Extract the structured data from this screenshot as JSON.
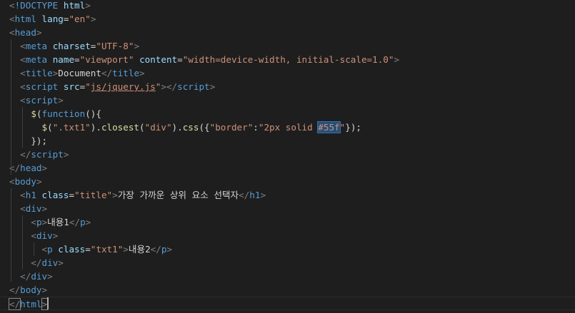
{
  "editor": {
    "lines": [
      [
        [
          "br",
          "<"
        ],
        [
          "tag",
          "!DOCTYPE"
        ],
        [
          "txt",
          " "
        ],
        [
          "attr",
          "html"
        ],
        [
          "br",
          ">"
        ]
      ],
      [
        [
          "br",
          "<"
        ],
        [
          "tag",
          "html"
        ],
        [
          "txt",
          " "
        ],
        [
          "attr",
          "lang"
        ],
        [
          "txt",
          "="
        ],
        [
          "str",
          "\"en\""
        ],
        [
          "br",
          ">"
        ]
      ],
      [
        [
          "br",
          "<"
        ],
        [
          "tag",
          "head"
        ],
        [
          "br",
          ">"
        ]
      ],
      [
        [
          "txt",
          "  "
        ],
        [
          "br",
          "<"
        ],
        [
          "tag",
          "meta"
        ],
        [
          "txt",
          " "
        ],
        [
          "attr",
          "charset"
        ],
        [
          "txt",
          "="
        ],
        [
          "str",
          "\"UTF-8\""
        ],
        [
          "br",
          ">"
        ]
      ],
      [
        [
          "txt",
          "  "
        ],
        [
          "br",
          "<"
        ],
        [
          "tag",
          "meta"
        ],
        [
          "txt",
          " "
        ],
        [
          "attr",
          "name"
        ],
        [
          "txt",
          "="
        ],
        [
          "str",
          "\"viewport\""
        ],
        [
          "txt",
          " "
        ],
        [
          "attr",
          "content"
        ],
        [
          "txt",
          "="
        ],
        [
          "str",
          "\"width=device-width, initial-scale=1.0\""
        ],
        [
          "br",
          ">"
        ]
      ],
      [
        [
          "txt",
          "  "
        ],
        [
          "br",
          "<"
        ],
        [
          "tag",
          "title"
        ],
        [
          "br",
          ">"
        ],
        [
          "txt",
          "Document"
        ],
        [
          "br",
          "</"
        ],
        [
          "tag",
          "title"
        ],
        [
          "br",
          ">"
        ]
      ],
      [
        [
          "txt",
          "  "
        ],
        [
          "br",
          "<"
        ],
        [
          "tag",
          "script"
        ],
        [
          "txt",
          " "
        ],
        [
          "attr",
          "src"
        ],
        [
          "txt",
          "="
        ],
        [
          "str",
          "\""
        ],
        [
          "link",
          "js/jquery.js"
        ],
        [
          "str",
          "\""
        ],
        [
          "br",
          "></"
        ],
        [
          "tag",
          "script"
        ],
        [
          "br",
          ">"
        ]
      ],
      [
        [
          "txt",
          "  "
        ],
        [
          "br",
          "<"
        ],
        [
          "tag",
          "script"
        ],
        [
          "br",
          ">"
        ]
      ],
      [
        [
          "txt",
          "    "
        ],
        [
          "fn",
          "$"
        ],
        [
          "punc",
          "("
        ],
        [
          "kw",
          "function"
        ],
        [
          "punc",
          "(){"
        ]
      ],
      [
        [
          "txt",
          "      "
        ],
        [
          "fn",
          "$"
        ],
        [
          "punc",
          "("
        ],
        [
          "str",
          "\".txt1\""
        ],
        [
          "punc",
          ")."
        ],
        [
          "fn",
          "closest"
        ],
        [
          "punc",
          "("
        ],
        [
          "str",
          "\"div\""
        ],
        [
          "punc",
          ")."
        ],
        [
          "fn",
          "css"
        ],
        [
          "punc",
          "({"
        ],
        [
          "str",
          "\"border\""
        ],
        [
          "punc",
          ":"
        ],
        [
          "str",
          "\"2px solid "
        ],
        [
          "sel",
          "#55f"
        ],
        [
          "str",
          "\""
        ],
        [
          "punc",
          "});"
        ]
      ],
      [
        [
          "txt",
          "    "
        ],
        [
          "punc",
          "});"
        ]
      ],
      [
        [
          "txt",
          "  "
        ],
        [
          "br",
          "</"
        ],
        [
          "tag",
          "script"
        ],
        [
          "br",
          ">"
        ]
      ],
      [
        [
          "br",
          "</"
        ],
        [
          "tag",
          "head"
        ],
        [
          "br",
          ">"
        ]
      ],
      [
        [
          "br",
          "<"
        ],
        [
          "tag",
          "body"
        ],
        [
          "br",
          ">"
        ]
      ],
      [
        [
          "txt",
          "  "
        ],
        [
          "br",
          "<"
        ],
        [
          "tag",
          "h1"
        ],
        [
          "txt",
          " "
        ],
        [
          "attr",
          "class"
        ],
        [
          "txt",
          "="
        ],
        [
          "str",
          "\"title\""
        ],
        [
          "br",
          ">"
        ],
        [
          "txt",
          "가장 가까운 상위 요소 선택자"
        ],
        [
          "br",
          "</"
        ],
        [
          "tag",
          "h1"
        ],
        [
          "br",
          ">"
        ]
      ],
      [
        [
          "txt",
          "  "
        ],
        [
          "br",
          "<"
        ],
        [
          "tag",
          "div"
        ],
        [
          "br",
          ">"
        ]
      ],
      [
        [
          "txt",
          "    "
        ],
        [
          "br",
          "<"
        ],
        [
          "tag",
          "p"
        ],
        [
          "br",
          ">"
        ],
        [
          "txt",
          "내용1"
        ],
        [
          "br",
          "</"
        ],
        [
          "tag",
          "p"
        ],
        [
          "br",
          ">"
        ]
      ],
      [
        [
          "txt",
          "    "
        ],
        [
          "br",
          "<"
        ],
        [
          "tag",
          "div"
        ],
        [
          "br",
          ">"
        ]
      ],
      [
        [
          "txt",
          "      "
        ],
        [
          "br",
          "<"
        ],
        [
          "tag",
          "p"
        ],
        [
          "txt",
          " "
        ],
        [
          "attr",
          "class"
        ],
        [
          "txt",
          "="
        ],
        [
          "str",
          "\"txt1\""
        ],
        [
          "br",
          ">"
        ],
        [
          "txt",
          "내용2"
        ],
        [
          "br",
          "</"
        ],
        [
          "tag",
          "p"
        ],
        [
          "br",
          ">"
        ]
      ],
      [
        [
          "txt",
          "    "
        ],
        [
          "br",
          "</"
        ],
        [
          "tag",
          "div"
        ],
        [
          "br",
          ">"
        ]
      ],
      [
        [
          "txt",
          "  "
        ],
        [
          "br",
          "</"
        ],
        [
          "tag",
          "div"
        ],
        [
          "br",
          ">"
        ]
      ],
      [
        [
          "br",
          "</"
        ],
        [
          "tag",
          "body"
        ],
        [
          "br",
          ">"
        ]
      ],
      [
        [
          "br",
          "</"
        ],
        [
          "tag",
          "html"
        ],
        [
          "br",
          ">"
        ]
      ]
    ]
  }
}
